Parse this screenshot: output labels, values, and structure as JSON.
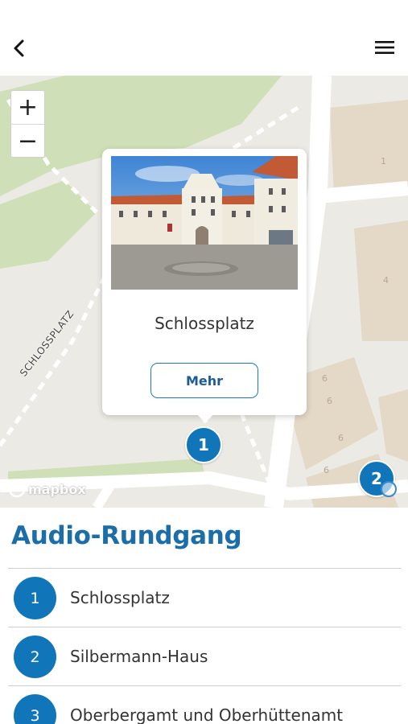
{
  "header": {
    "back_icon": "chevron-left-icon",
    "menu_icon": "hamburger-menu-icon"
  },
  "map": {
    "zoom_in_label": "+",
    "zoom_out_label": "−",
    "street_label": "SCHLOSSPLATZ",
    "building_numbers": [
      "1",
      "4",
      "6",
      "6",
      "6",
      "6"
    ],
    "popup": {
      "title": "Schlossplatz",
      "button_label": "Mehr"
    },
    "markers": [
      {
        "number": "1"
      },
      {
        "number": "2"
      }
    ],
    "attribution_logo": "mapbox",
    "info_icon": "info-icon"
  },
  "section": {
    "title": "Audio-Rundgang"
  },
  "stops": [
    {
      "number": "1",
      "name": "Schlossplatz"
    },
    {
      "number": "2",
      "name": "Silbermann-Haus"
    },
    {
      "number": "3",
      "name": "Oberbergamt und Oberhüttenamt"
    }
  ],
  "colors": {
    "accent": "#1076b9",
    "title": "#1c6ea9",
    "map_background": "#eceae4",
    "park": "#cfe0b8",
    "building": "#e4d8c6"
  }
}
